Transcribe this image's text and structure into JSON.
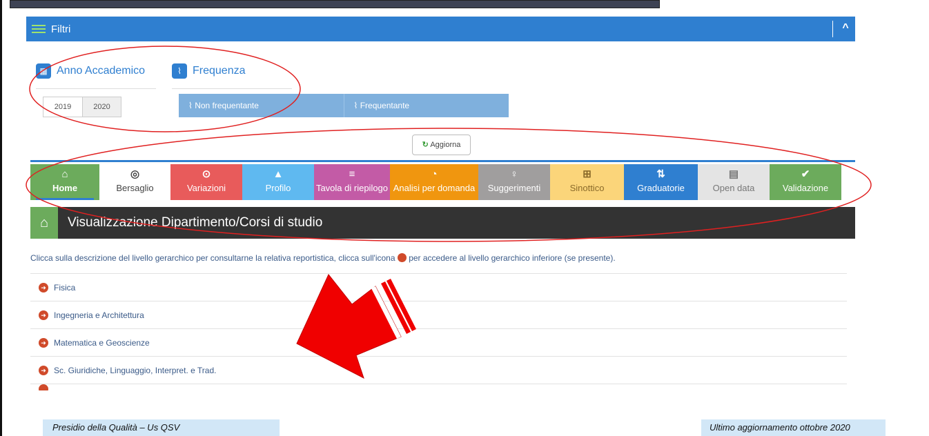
{
  "filters": {
    "title": "Filtri",
    "toggle": "^",
    "anno": {
      "label": "Anno Accademico",
      "icon": "calendar-icon",
      "years": [
        "2019",
        "2020"
      ]
    },
    "frequenza": {
      "label": "Frequenza",
      "icon": "pulse-icon",
      "options": [
        "Non frequentante",
        "Frequentante"
      ]
    }
  },
  "aggiorna_label": "Aggiorna",
  "tabs": [
    {
      "label": "Home",
      "icon": "home-icon",
      "glyph": "⌂",
      "color": "#6cab5c",
      "text_color": "#ffffff"
    },
    {
      "label": "Bersaglio",
      "icon": "target-icon",
      "glyph": "◎",
      "color": "#ffffff",
      "text_color": "#444444"
    },
    {
      "label": "Variazioni",
      "icon": "circle-dot-icon",
      "glyph": "⊙",
      "color": "#e85b5b",
      "text_color": "#ffffff"
    },
    {
      "label": "Profilo",
      "icon": "line-chart-icon",
      "glyph": "▲",
      "color": "#5fb9f0",
      "text_color": "#ffffff"
    },
    {
      "label": "Tavola di riepilogo",
      "icon": "list-icon",
      "glyph": "≡",
      "color": "#c35ba6",
      "text_color": "#ffffff"
    },
    {
      "label": "Analisi per domanda",
      "icon": "dashboard-icon",
      "glyph": "◔",
      "color": "#f0960f",
      "text_color": "#ffffff"
    },
    {
      "label": "Suggerimenti",
      "icon": "lightbulb-icon",
      "glyph": "♀",
      "color": "#a09e9e",
      "text_color": "#ffffff"
    },
    {
      "label": "Sinottico",
      "icon": "grid-icon",
      "glyph": "⊞",
      "color": "#fbd57a",
      "text_color": "#8a6a2a"
    },
    {
      "label": "Graduatorie",
      "icon": "sort-icon",
      "glyph": "⇅",
      "color": "#2f7fd0",
      "text_color": "#ffffff"
    },
    {
      "label": "Open data",
      "icon": "table-icon",
      "glyph": "▤",
      "color": "#e4e4e4",
      "text_color": "#777777"
    },
    {
      "label": "Validazione",
      "icon": "thumbs-up-icon",
      "glyph": "✔",
      "color": "#6cab5c",
      "text_color": "#ffffff"
    }
  ],
  "department_header": "Visualizzazione Dipartimento/Corsi di studio",
  "instructions": {
    "before": "Clicca sulla descrizione del livello gerarchico per consultarne la relativa reportistica, clicca sull'icona ",
    "after": " per accedere al livello gerarchico inferiore (se presente)."
  },
  "departments": [
    "Fisica",
    "Ingegneria e Architettura",
    "Matematica e Geoscienze",
    "Sc. Giuridiche, Linguaggio, Interpret. e Trad."
  ],
  "footer": {
    "left": "Presidio della Qualità – Us QSV",
    "right": "Ultimo aggiornamento ottobre 2020"
  },
  "colors": {
    "accent": "#2f7fd0",
    "annotation": "#e02020",
    "footer_bg": "#d2e7f7"
  }
}
